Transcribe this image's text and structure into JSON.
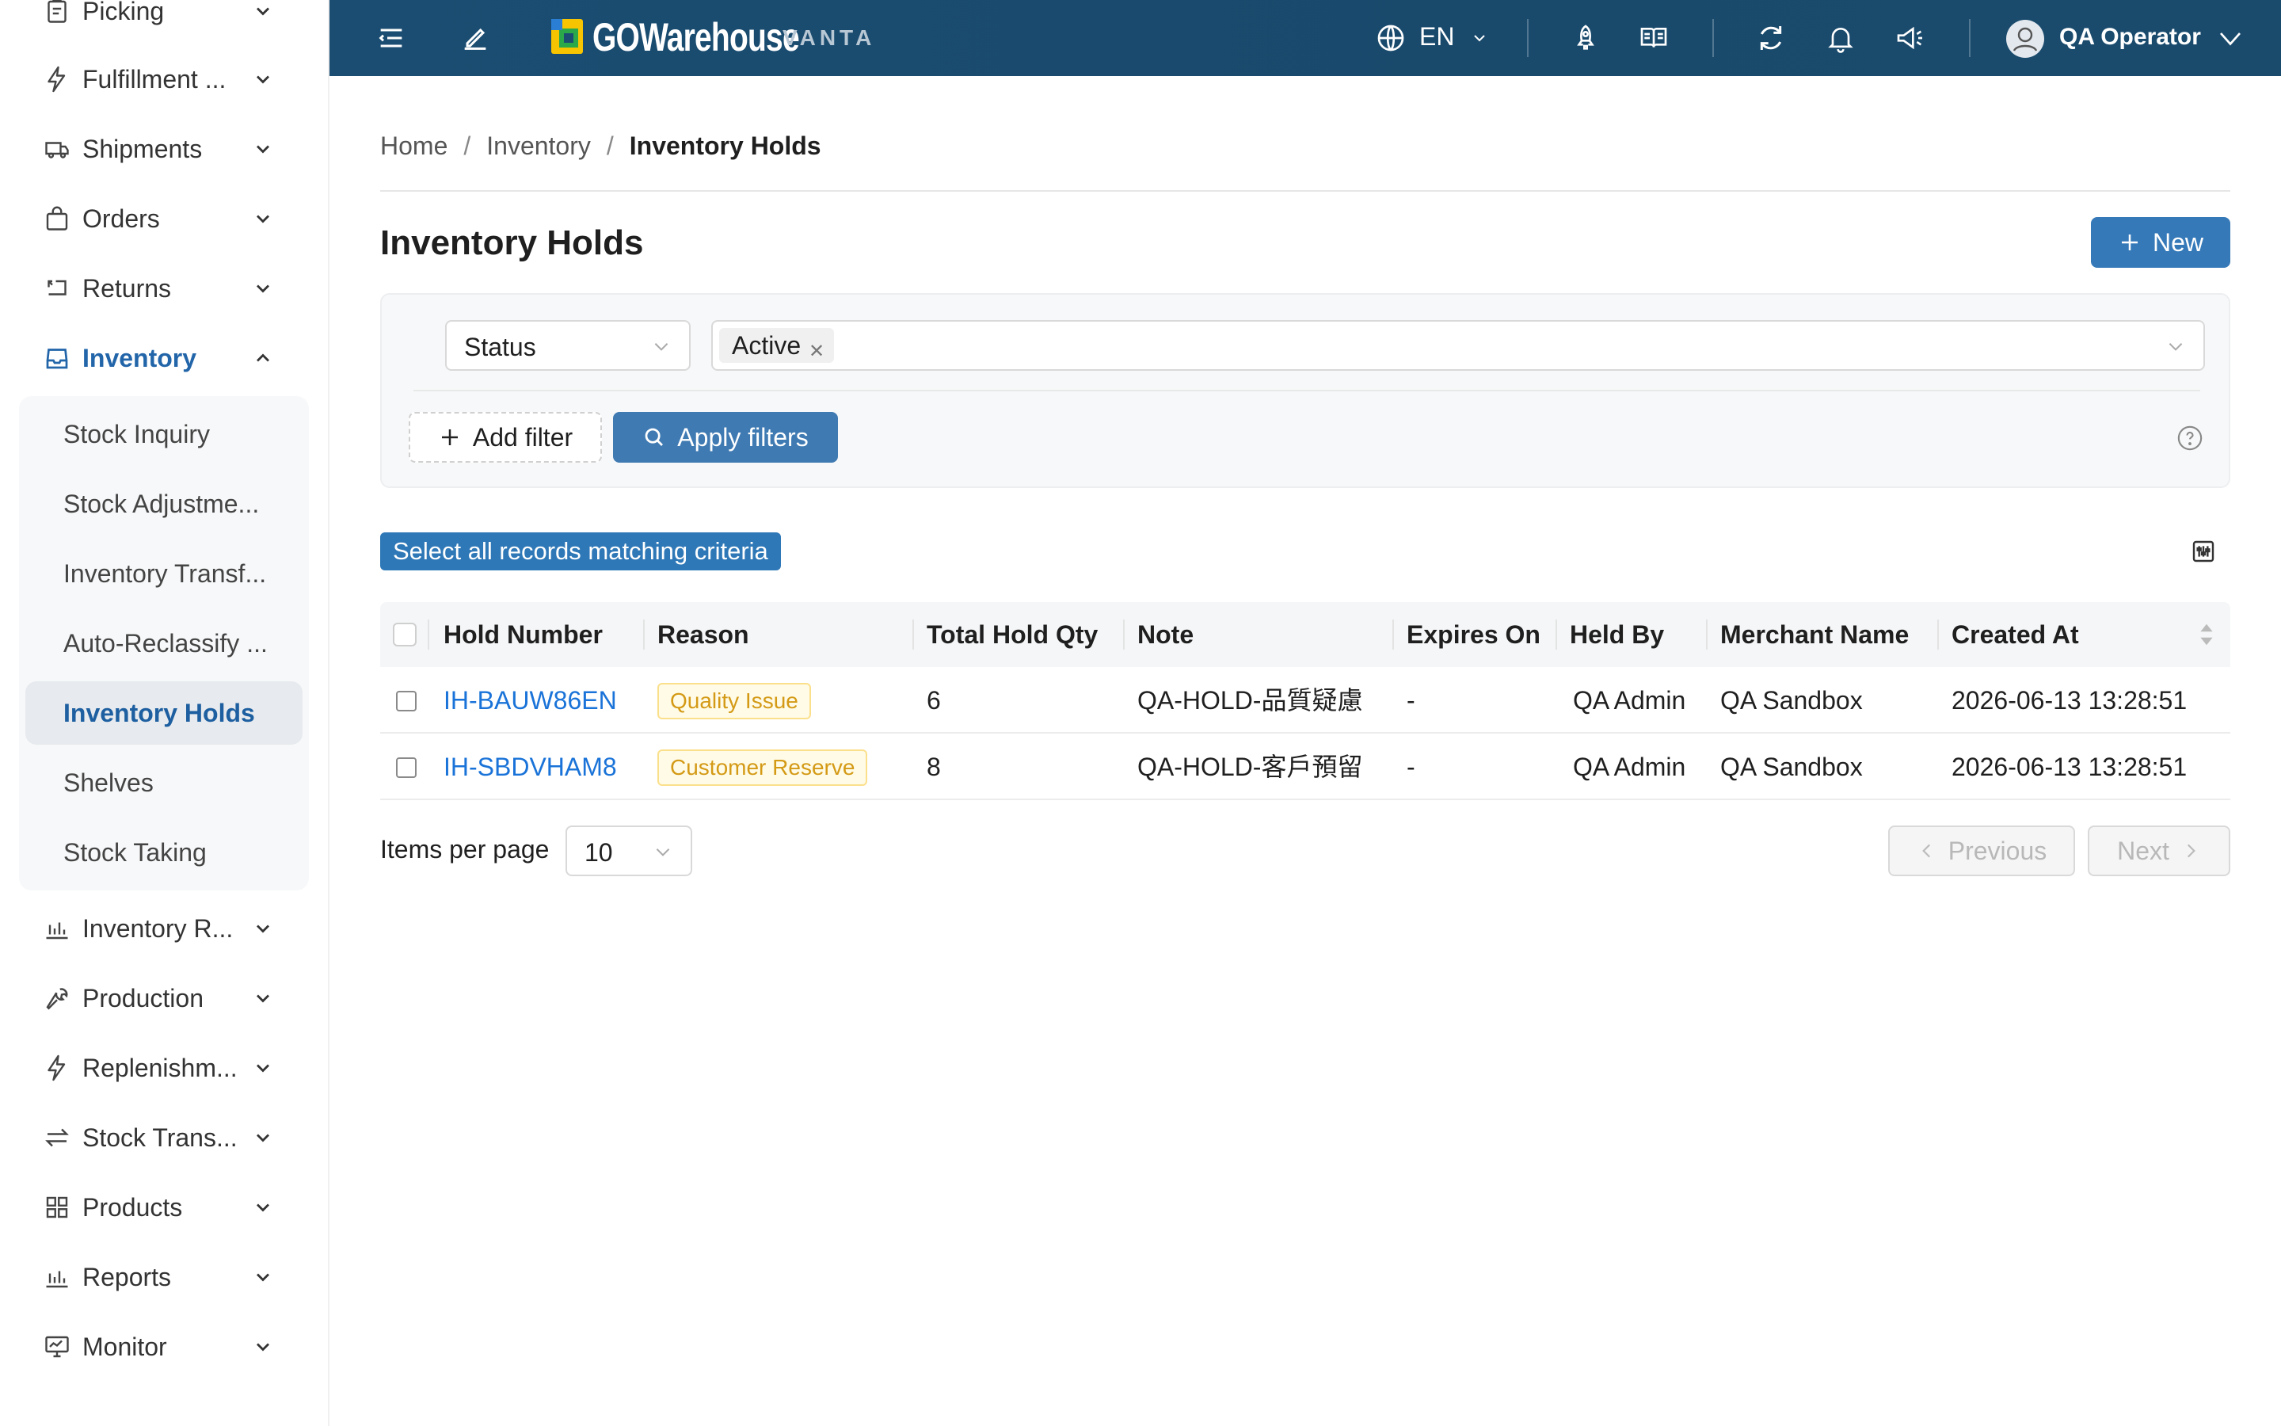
{
  "sidebar": {
    "items": [
      {
        "label": "Picking",
        "icon": "picking-icon"
      },
      {
        "label": "Fulfillment ...",
        "icon": "lightning-icon"
      },
      {
        "label": "Shipments",
        "icon": "truck-icon"
      },
      {
        "label": "Orders",
        "icon": "shopping-bag-icon"
      },
      {
        "label": "Returns",
        "icon": "return-icon"
      },
      {
        "label": "Inventory",
        "icon": "inbox-icon",
        "expanded": true
      },
      {
        "label": "Inventory R...",
        "icon": "bar-chart-icon"
      },
      {
        "label": "Production",
        "icon": "wrench-icon"
      },
      {
        "label": "Replenishm...",
        "icon": "lightning-icon"
      },
      {
        "label": "Stock Trans...",
        "icon": "swap-icon"
      },
      {
        "label": "Products",
        "icon": "grid-icon"
      },
      {
        "label": "Reports",
        "icon": "bar-chart-icon"
      },
      {
        "label": "Monitor",
        "icon": "monitor-icon"
      }
    ],
    "inventory_submenu": [
      {
        "label": "Stock Inquiry"
      },
      {
        "label": "Stock Adjustme..."
      },
      {
        "label": "Inventory Transf..."
      },
      {
        "label": "Auto-Reclassify ..."
      },
      {
        "label": "Inventory Holds",
        "active": true
      },
      {
        "label": "Shelves"
      },
      {
        "label": "Stock Taking"
      }
    ]
  },
  "header": {
    "brand": "GOWarehouse",
    "brand_suffix": "VANTA",
    "language": "EN",
    "user": "QA Operator",
    "icons": [
      "menu-collapse-icon",
      "edit-icon",
      "globe-icon",
      "rocket-icon",
      "book-icon",
      "refresh-icon",
      "bell-icon",
      "megaphone-icon",
      "user-avatar-icon"
    ]
  },
  "breadcrumb": [
    "Home",
    "Inventory",
    "Inventory Holds"
  ],
  "page_title": "Inventory Holds",
  "new_button": "New",
  "filters": {
    "field": "Status",
    "value_tag": "Active",
    "add_filter_label": "Add filter",
    "apply_label": "Apply filters"
  },
  "select_all_label": "Select all records matching criteria",
  "table": {
    "columns": [
      "Hold Number",
      "Reason",
      "Total Hold Qty",
      "Note",
      "Expires On",
      "Held By",
      "Merchant Name",
      "Created At"
    ],
    "rows": [
      {
        "hold_number": "IH-BAUW86EN",
        "reason": "Quality Issue",
        "qty": "6",
        "note": "QA-HOLD-品質疑慮",
        "expires_on": "-",
        "held_by": "QA Admin",
        "merchant": "QA Sandbox",
        "created_at": "2026-06-13 13:28:51"
      },
      {
        "hold_number": "IH-SBDVHAM8",
        "reason": "Customer Reserve",
        "qty": "8",
        "note": "QA-HOLD-客戶預留",
        "expires_on": "-",
        "held_by": "QA Admin",
        "merchant": "QA Sandbox",
        "created_at": "2026-06-13 13:28:51"
      }
    ]
  },
  "pagination": {
    "items_per_page_label": "Items per page",
    "items_per_page": "10",
    "previous_label": "Previous",
    "next_label": "Next"
  },
  "colors": {
    "header_bg": "#1b4d72",
    "primary": "#3579b8",
    "link": "#1a73d8",
    "active_nav": "#2265a9",
    "badge_text": "#d49a16",
    "badge_bg": "#fffbe6"
  }
}
